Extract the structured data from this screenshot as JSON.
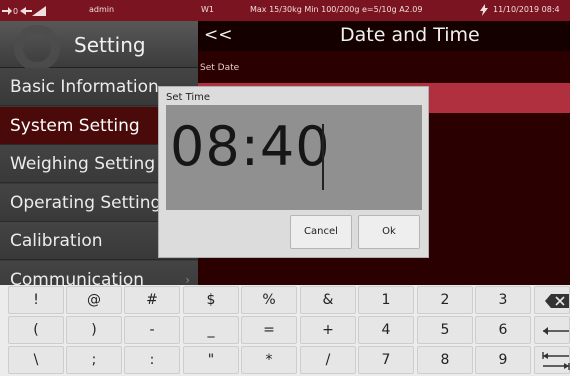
{
  "statusbar": {
    "user": "admin",
    "scale": "W1",
    "capacity": "Max 15/30kg  Min 100/200g e=5/10g A2.09",
    "datetime": "11/10/2019 08:4",
    "icons": [
      "signal-arrows-icon",
      "antenna-icon",
      "power-icon"
    ]
  },
  "sidebar": {
    "title": "Setting",
    "items": [
      {
        "label": "Basic Information"
      },
      {
        "label": "System Setting"
      },
      {
        "label": "Weighing Setting"
      },
      {
        "label": "Operating Setting"
      },
      {
        "label": "Calibration"
      },
      {
        "label": "Communication"
      }
    ]
  },
  "main": {
    "back_label": "<<",
    "title": "Date and Time",
    "section_label": "Set Date"
  },
  "dialog": {
    "title": "Set Time",
    "time_value": "08:40",
    "cancel_label": "Cancel",
    "ok_label": "Ok"
  },
  "keyboard": {
    "row1": [
      "!",
      "@",
      "#",
      "$",
      "%",
      "&",
      "1",
      "2",
      "3"
    ],
    "row2": [
      "(",
      ")",
      "-",
      "_",
      "=",
      "+",
      "4",
      "5",
      "6"
    ],
    "row3": [
      "\\",
      ";",
      ":",
      "\"",
      "*",
      "/",
      "7",
      "8",
      "9"
    ],
    "special_icons": [
      "backspace-icon",
      "left-arrow-icon",
      "tab-icon"
    ]
  },
  "colors": {
    "statusbar": "#7a1420",
    "selection": "#b03040",
    "active_menu": "#4a0a0a"
  }
}
